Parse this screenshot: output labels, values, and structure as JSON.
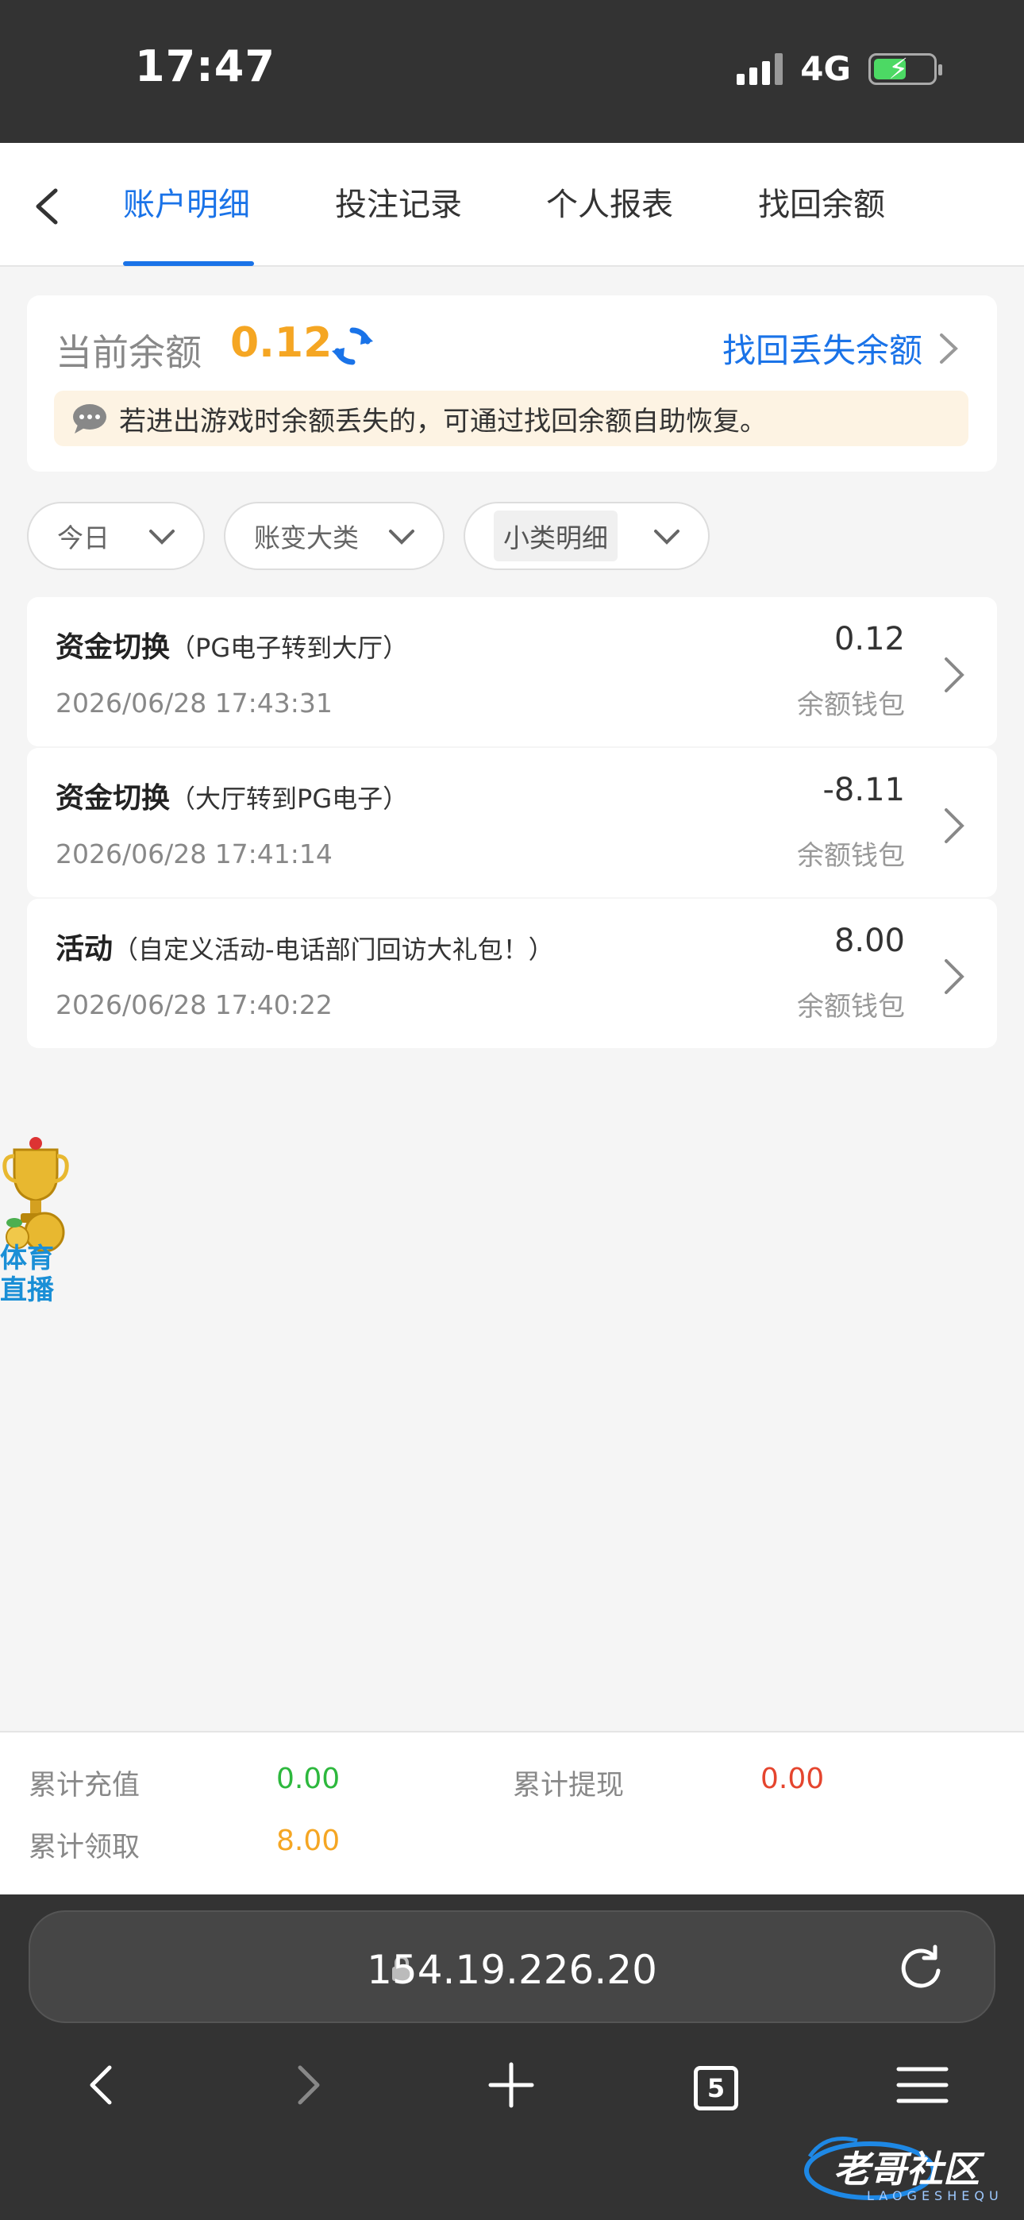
{
  "status": {
    "time": "17:47",
    "network": "4G"
  },
  "nav": {
    "tabs": [
      {
        "label": "账户明细"
      },
      {
        "label": "投注记录"
      },
      {
        "label": "个人报表"
      },
      {
        "label": "找回余额"
      }
    ]
  },
  "balance": {
    "label": "当前余额",
    "value": "0.12",
    "recover_link": "找回丢失余额",
    "notice": "若进出游戏时余额丢失的，可通过找回余额自助恢复。"
  },
  "filters": [
    {
      "label": "今日"
    },
    {
      "label": "账变大类"
    },
    {
      "label": "小类明细"
    }
  ],
  "records": [
    {
      "type": "资金切换",
      "detail": "（PG电子转到大厅）",
      "time": "2026/06/28 17:43:31",
      "amount": "0.12",
      "wallet": "余额钱包"
    },
    {
      "type": "资金切换",
      "detail": "（大厅转到PG电子）",
      "time": "2026/06/28 17:41:14",
      "amount": "-8.11",
      "wallet": "余额钱包"
    },
    {
      "type": "活动",
      "detail": "（自定义活动-电话部门回访大礼包！）",
      "time": "2026/06/28 17:40:22",
      "amount": "8.00",
      "wallet": "余额钱包"
    }
  ],
  "widget": {
    "line1": "体育",
    "line2": "直播"
  },
  "summary": {
    "recharge_label": "累计充值",
    "recharge_value": "0.00",
    "withdraw_label": "累计提现",
    "withdraw_value": "0.00",
    "claim_label": "累计领取",
    "claim_value": "8.00"
  },
  "colors": {
    "accent": "#1a73e8",
    "balance": "#f5a623",
    "recharge": "#2db83d",
    "withdraw": "#e5452e"
  },
  "browser": {
    "url": "154.19.226.20",
    "tab_count": "5"
  },
  "watermark": {
    "text": "老哥社区",
    "sub": "LAOGESHEQU"
  }
}
